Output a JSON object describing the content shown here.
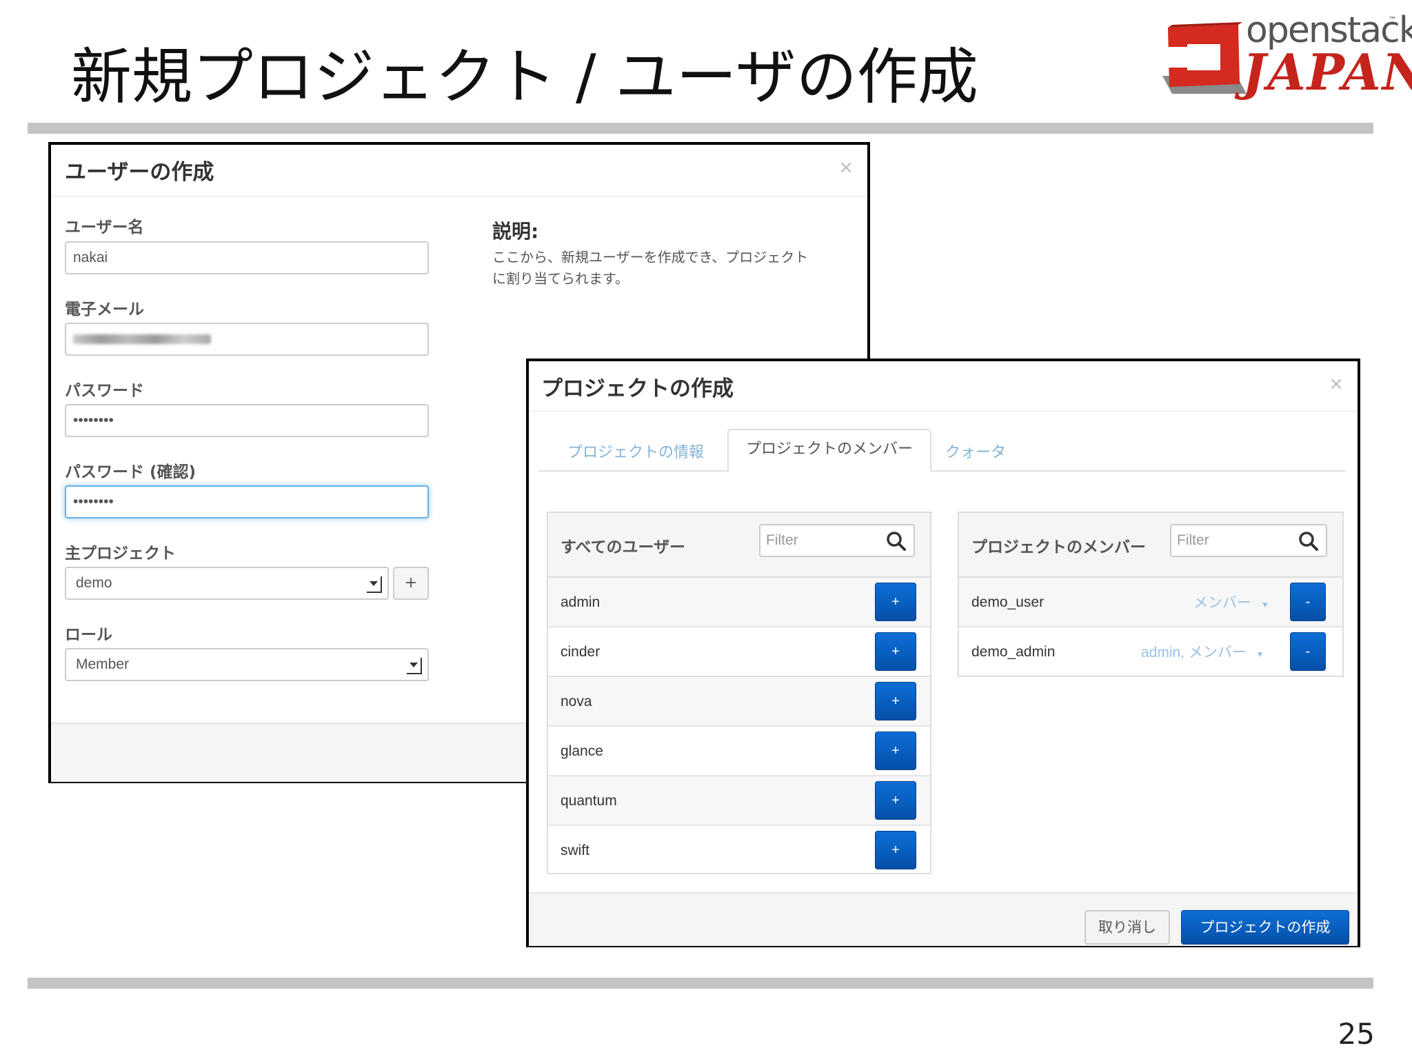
{
  "slide": {
    "title": "新規プロジェクト / ユーザの作成",
    "page_number": "25",
    "logo": {
      "top": "openstack",
      "tm": "™",
      "bottom": "JAPAN"
    }
  },
  "user_dialog": {
    "title": "ユーザーの作成",
    "close": "×",
    "username_label": "ユーザー名",
    "username_value": "nakai",
    "email_label": "電子メール",
    "password_label": "パスワード",
    "password_value": "••••••••",
    "password_confirm_label": "パスワード (確認)",
    "password_confirm_value": "••••••••",
    "project_label": "主プロジェクト",
    "project_value": "demo",
    "add_project": "+",
    "role_label": "ロール",
    "role_value": "Member",
    "description_title": "説明:",
    "description_line1": "ここから、新規ユーザーを作成でき、プロジェクト",
    "description_line2": "に割り当てられます。"
  },
  "project_dialog": {
    "title": "プロジェクトの作成",
    "close": "×",
    "tabs": [
      {
        "label": "プロジェクトの情報"
      },
      {
        "label": "プロジェクトのメンバー"
      },
      {
        "label": "クォータ"
      }
    ],
    "all_users": {
      "title": "すべてのユーザー",
      "filter_placeholder": "Filter",
      "users": [
        {
          "name": "admin",
          "action": "+"
        },
        {
          "name": "cinder",
          "action": "+"
        },
        {
          "name": "nova",
          "action": "+"
        },
        {
          "name": "glance",
          "action": "+"
        },
        {
          "name": "quantum",
          "action": "+"
        },
        {
          "name": "swift",
          "action": "+"
        }
      ]
    },
    "members": {
      "title": "プロジェクトのメンバー",
      "filter_placeholder": "Filter",
      "rows": [
        {
          "name": "demo_user",
          "role": "メンバー",
          "action": "-"
        },
        {
          "name": "demo_admin",
          "role": "admin, メンバー",
          "action": "-"
        }
      ]
    },
    "cancel_label": "取り消し",
    "submit_label": "プロジェクトの作成"
  }
}
